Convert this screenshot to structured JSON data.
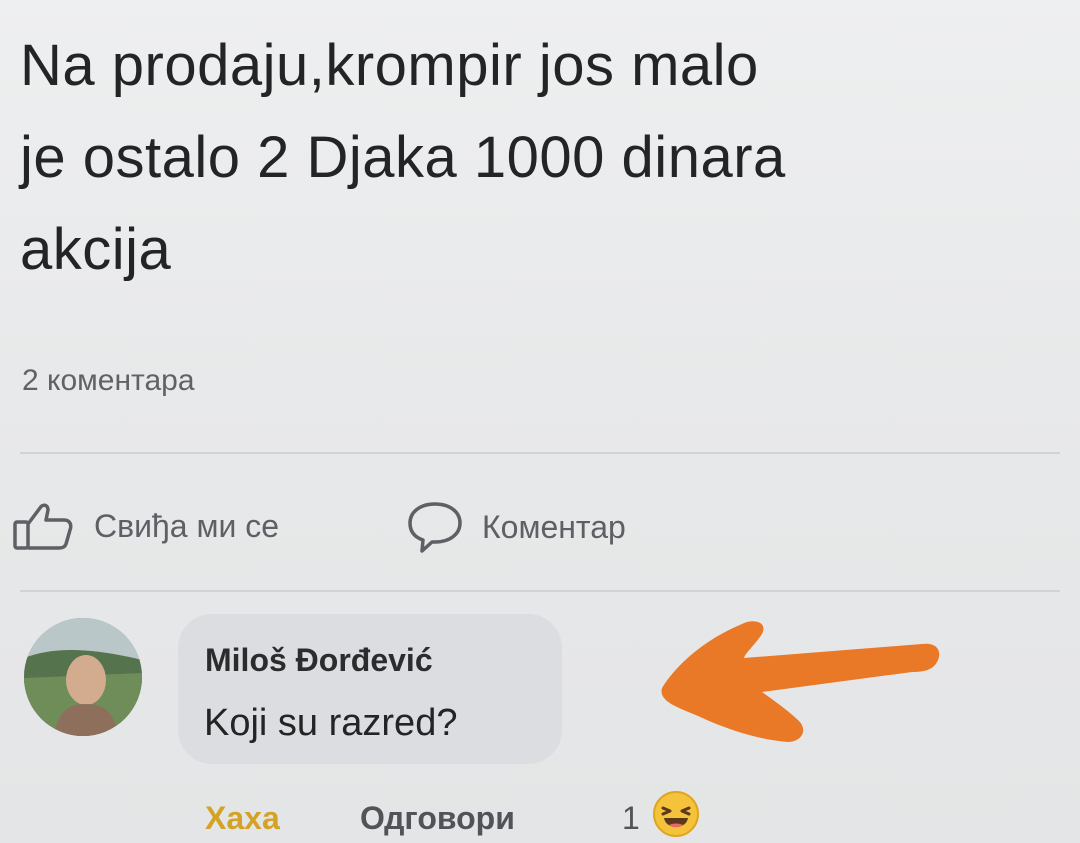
{
  "post": {
    "text": "Na  prodaju,krompir   jos malo\nje ostalo 2 Djaka 1000 dinara\nakcija",
    "comment_count": "2 коментара"
  },
  "actions": {
    "like_label": "Свиђа ми се",
    "comment_label": "Коментар"
  },
  "comment": {
    "author": "Miloš Đorđević",
    "text": "Koji su razred?",
    "haha_label": "Хаха",
    "reply_label": "Одговори",
    "reaction_count": "1"
  },
  "colors": {
    "annotation_arrow": "#e9741f",
    "haha": "#d4a326"
  },
  "icons": {
    "like": "thumbs-up-icon",
    "comment": "speech-bubble-icon",
    "reaction": "laughing-emoji-icon",
    "annotation": "arrow-left-annotation"
  }
}
